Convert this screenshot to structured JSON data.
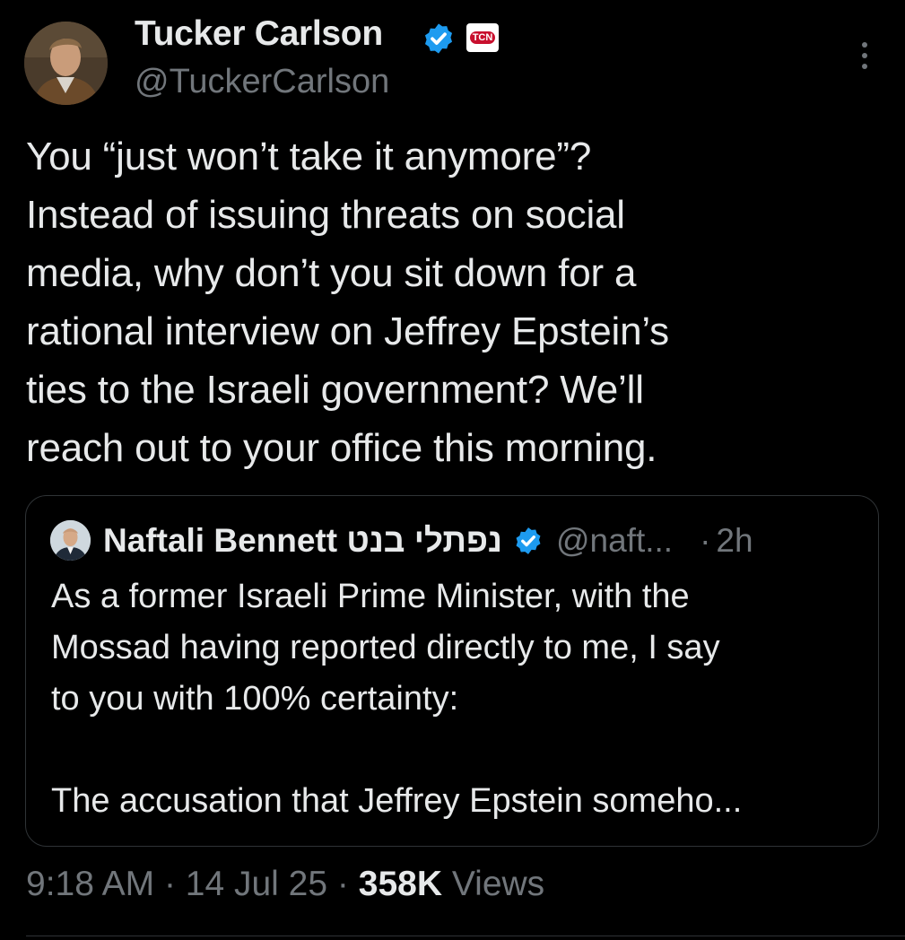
{
  "author": {
    "name": "Tucker Carlson",
    "handle": "@TuckerCarlson",
    "affiliate_badge": "TCN"
  },
  "tweet": {
    "text": "You “just won’t take it anymore”?\nInstead of issuing threats on social\nmedia, why don’t you sit down for a\nrational interview on Jeffrey Epstein’s\nties to the Israeli government? We’ll\nreach out to your office this morning."
  },
  "quoted_tweet": {
    "name": "Naftali Bennett נפתלי בנט",
    "handle": "@naft...",
    "separator": "·",
    "time": "2h",
    "text_lines": [
      "As a former Israeli Prime Minister, with the",
      "Mossad having reported directly to me, I say",
      "to you with 100% certainty:"
    ],
    "text_continued": "The accusation that Jeffrey Epstein someho..."
  },
  "meta": {
    "time": "9:18 AM",
    "date": "14 Jul 25",
    "separator": "·",
    "views_count": "358K",
    "views_label": "Views"
  },
  "colors": {
    "background": "#000000",
    "text": "#e7e9ea",
    "secondary": "#71767b",
    "verified_blue": "#1d9bf0",
    "border": "#2f3336"
  },
  "icons": {
    "verified": "verified-badge-icon",
    "affiliate": "tcn-affiliate-icon",
    "more": "more-options-icon"
  }
}
